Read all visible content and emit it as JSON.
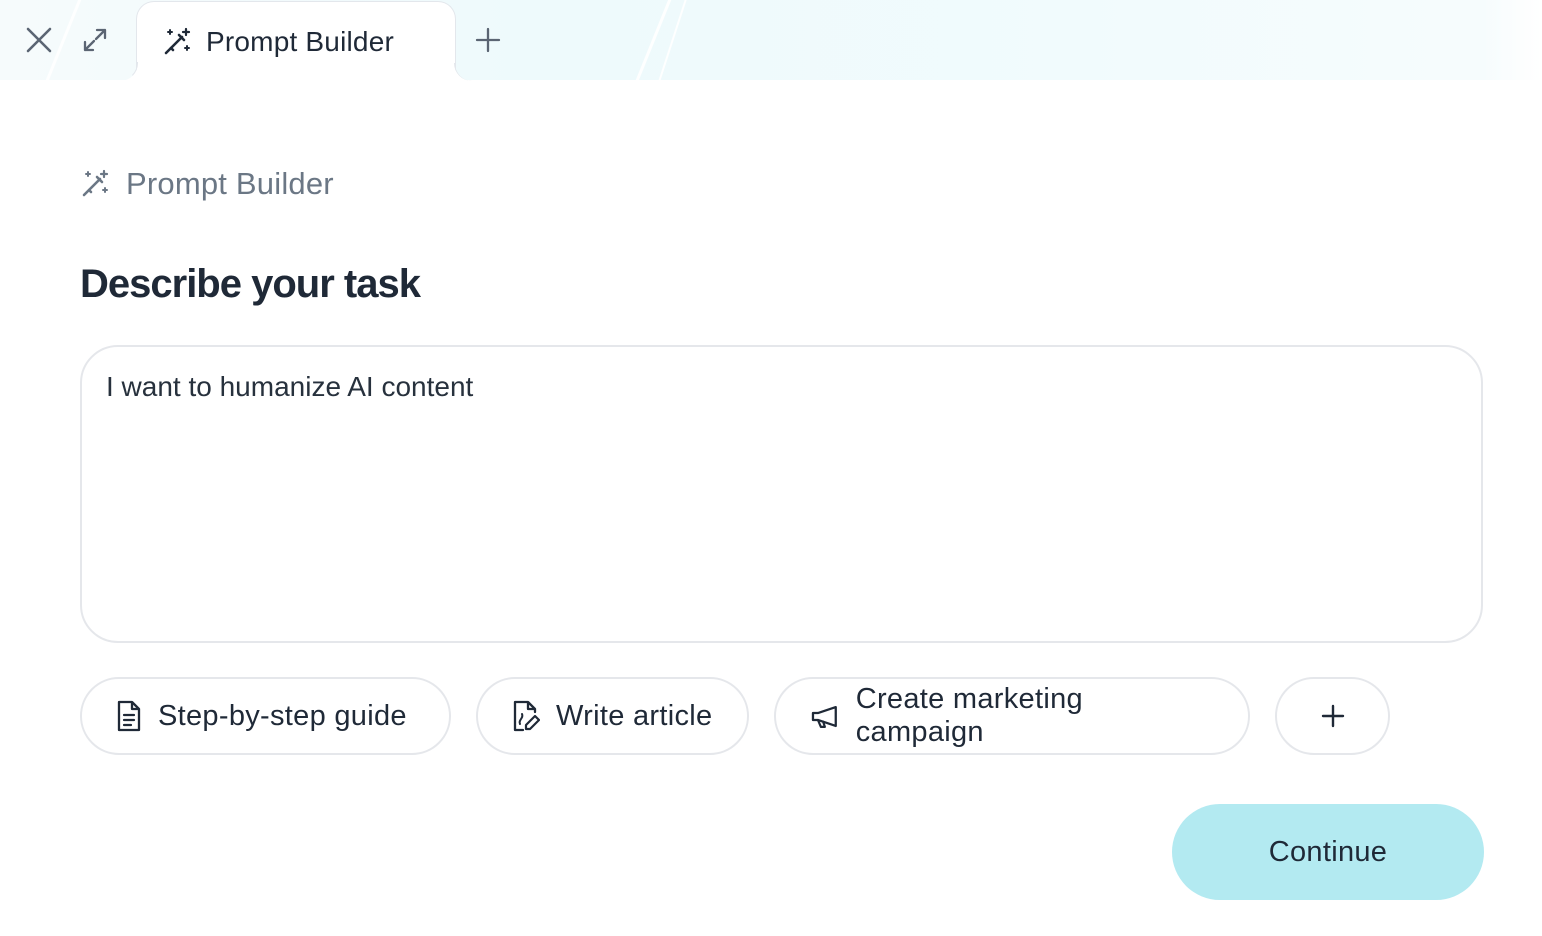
{
  "tab": {
    "title": "Prompt Builder",
    "icon": "magic-wand-icon"
  },
  "window_controls": {
    "close_icon": "close-icon",
    "expand_icon": "expand-icon",
    "new_tab_icon": "plus-icon"
  },
  "section": {
    "label": "Prompt Builder",
    "icon": "magic-wand-icon"
  },
  "main": {
    "title": "Describe your task",
    "task_input_value": "I want to humanize AI content"
  },
  "suggestions": [
    {
      "label": "Step-by-step guide",
      "icon": "document-icon"
    },
    {
      "label": "Write article",
      "icon": "edit-document-icon"
    },
    {
      "label": "Create marketing campaign",
      "icon": "megaphone-icon"
    }
  ],
  "more_suggestions_icon": "plus-icon",
  "actions": {
    "continue_label": "Continue"
  },
  "colors": {
    "accent": "#b3eaf1",
    "text": "#1f2937",
    "muted": "#6b7785",
    "border": "#e5e7eb"
  }
}
